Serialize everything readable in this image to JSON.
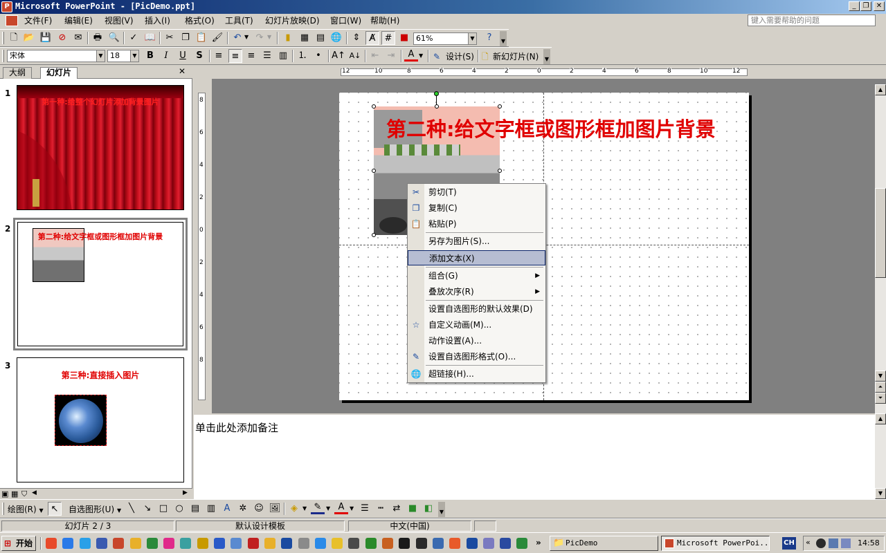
{
  "window": {
    "title": "Microsoft PowerPoint - [PicDemo.ppt]",
    "app_icon": "P"
  },
  "menu": {
    "items": [
      "文件(F)",
      "编辑(E)",
      "视图(V)",
      "插入(I)",
      "格式(O)",
      "工具(T)",
      "幻灯片放映(D)",
      "窗口(W)",
      "帮助(H)"
    ],
    "help_placeholder": "键入需要帮助的问题"
  },
  "toolbar": {
    "zoom": "61%",
    "font_name": "宋体",
    "font_size": "18",
    "bold": "B",
    "italic": "I",
    "underline": "U",
    "shadow": "S",
    "design_label": "设计(S)",
    "new_slide_label": "新幻灯片(N)"
  },
  "left_pane": {
    "tabs": [
      "大纲",
      "幻灯片"
    ],
    "active_tab": "幻灯片",
    "slides": [
      {
        "num": "1",
        "title": "第一种:给整个幻灯片添加背景图片"
      },
      {
        "num": "2",
        "title": "第二种:给文字框或图形框加图片背景"
      },
      {
        "num": "3",
        "title": "第三种:直接插入图片"
      }
    ]
  },
  "slide": {
    "title": "第二种:给文字框或图形框加图片背景",
    "ruler_h_labels": [
      "12",
      "10",
      "8",
      "6",
      "4",
      "2",
      "0",
      "2",
      "4",
      "6",
      "8",
      "10",
      "12"
    ],
    "ruler_v_labels": [
      "8",
      "6",
      "4",
      "2",
      "0",
      "2",
      "4",
      "6",
      "8"
    ]
  },
  "context_menu": {
    "items": [
      {
        "label": "剪切(T)",
        "icon": "scissors-icon",
        "glyph": "✂"
      },
      {
        "label": "复制(C)",
        "icon": "copy-icon",
        "glyph": "❐"
      },
      {
        "label": "粘贴(P)",
        "icon": "paste-icon",
        "glyph": "📋"
      },
      {
        "label": "另存为图片(S)...",
        "icon": "",
        "glyph": ""
      },
      {
        "label": "添加文本(X)",
        "icon": "",
        "glyph": ""
      },
      {
        "label": "组合(G)",
        "icon": "",
        "glyph": "",
        "submenu": true
      },
      {
        "label": "叠放次序(R)",
        "icon": "",
        "glyph": "",
        "submenu": true
      },
      {
        "label": "设置自选图形的默认效果(D)",
        "icon": "",
        "glyph": ""
      },
      {
        "label": "自定义动画(M)...",
        "icon": "animation-icon",
        "glyph": "☆"
      },
      {
        "label": "动作设置(A)...",
        "icon": "",
        "glyph": ""
      },
      {
        "label": "设置自选图形格式(O)...",
        "icon": "format-shape-icon",
        "glyph": "✎"
      },
      {
        "label": "超链接(H)...",
        "icon": "hyperlink-icon",
        "glyph": "🌐"
      }
    ],
    "highlighted": "添加文本(X)"
  },
  "notes": {
    "placeholder": "单击此处添加备注"
  },
  "drawing_toolbar": {
    "draw_label": "绘图(R)",
    "autoshapes_label": "自选图形(U)"
  },
  "status": {
    "slide_counter": "幻灯片 2 / 3",
    "template": "默认设计模板",
    "language": "中文(中国)"
  },
  "taskbar": {
    "start_label": "开始",
    "tasks": [
      "PicDemo",
      "Microsoft PowerPoi..."
    ],
    "ime": "CH",
    "clock": "14:58"
  },
  "colors": {
    "title_red": "#e00000",
    "titlebar_start": "#0a246a",
    "menu_highlight": "#b6bdd2"
  }
}
